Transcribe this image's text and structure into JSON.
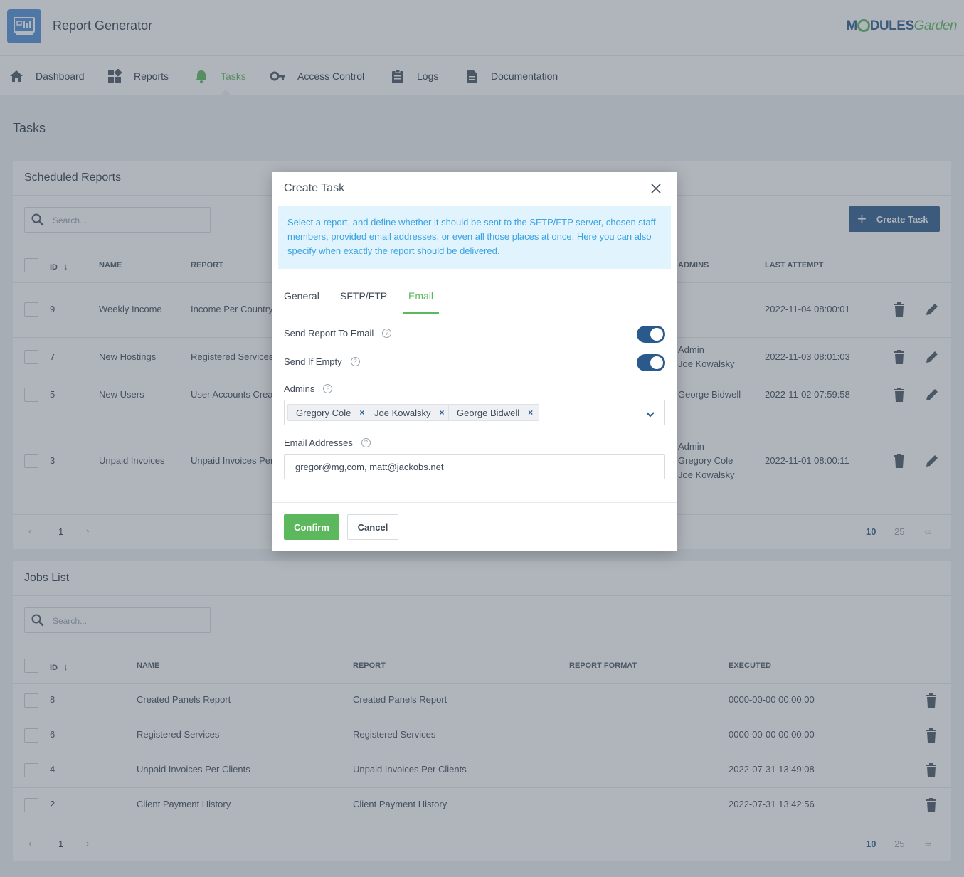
{
  "header": {
    "app_title": "Report Generator",
    "logo": {
      "modules": "M",
      "o": "",
      "dules": "DULES",
      "garden": "Garden"
    }
  },
  "nav": {
    "items": [
      {
        "label": "Dashboard",
        "icon": "home-icon"
      },
      {
        "label": "Reports",
        "icon": "dashboard-blocks-icon"
      },
      {
        "label": "Tasks",
        "icon": "bell-icon"
      },
      {
        "label": "Access Control",
        "icon": "key-icon"
      },
      {
        "label": "Logs",
        "icon": "clipboard-icon"
      },
      {
        "label": "Documentation",
        "icon": "document-icon"
      }
    ],
    "active": "Tasks"
  },
  "page_title": "Tasks",
  "scheduled": {
    "title": "Scheduled Reports",
    "search_placeholder": "Search...",
    "create_button": "Create Task",
    "columns": {
      "id": "ID",
      "name": "NAME",
      "report": "REPORT",
      "admins": "ADMINS",
      "last_attempt": "LAST ATTEMPT"
    },
    "rows": [
      {
        "id": "9",
        "name": "Weekly Income",
        "report": "Income Per Country",
        "admins": [],
        "last_attempt": "2022-11-04 08:00:01"
      },
      {
        "id": "7",
        "name": "New Hostings",
        "report": "Registered Services",
        "admins": [
          "Admin",
          "Joe Kowalsky"
        ],
        "last_attempt": "2022-11-03 08:01:03"
      },
      {
        "id": "5",
        "name": "New Users",
        "report": "User Accounts Crea",
        "admins": [
          "George Bidwell"
        ],
        "last_attempt": "2022-11-02 07:59:58"
      },
      {
        "id": "3",
        "name": "Unpaid Invoices",
        "report": "Unpaid Invoices Per",
        "admins": [
          "Admin",
          "Gregory Cole",
          "Joe Kowalsky"
        ],
        "last_attempt": "2022-11-01 08:00:11"
      }
    ],
    "pagination": {
      "current": "1",
      "sizes": [
        "10",
        "25",
        "∞"
      ],
      "active_size": "10"
    }
  },
  "jobs": {
    "title": "Jobs List",
    "search_placeholder": "Search...",
    "columns": {
      "id": "ID",
      "name": "NAME",
      "report": "REPORT",
      "format": "REPORT FORMAT",
      "executed": "EXECUTED"
    },
    "rows": [
      {
        "id": "8",
        "name": "Created Panels Report",
        "report": "Created Panels Report",
        "format": "",
        "executed": "0000-00-00 00:00:00"
      },
      {
        "id": "6",
        "name": "Registered Services",
        "report": "Registered Services",
        "format": "",
        "executed": "0000-00-00 00:00:00"
      },
      {
        "id": "4",
        "name": "Unpaid Invoices Per Clients",
        "report": "Unpaid Invoices Per Clients",
        "format": "",
        "executed": "2022-07-31 13:49:08"
      },
      {
        "id": "2",
        "name": "Client Payment History",
        "report": "Client Payment History",
        "format": "",
        "executed": "2022-07-31 13:42:56"
      }
    ],
    "pagination": {
      "current": "1",
      "sizes": [
        "10",
        "25",
        "∞"
      ],
      "active_size": "10"
    }
  },
  "modal": {
    "title": "Create Task",
    "info": "Select a report, and define whether it should be sent to the SFTP/FTP server, chosen staff members, provided email addresses, or even all those places at once. Here you can also specify when exactly the report should be delivered.",
    "tabs": [
      "General",
      "SFTP/FTP",
      "Email"
    ],
    "active_tab": "Email",
    "send_to_email_label": "Send Report To Email",
    "send_to_email": true,
    "send_if_empty_label": "Send If Empty",
    "send_if_empty": true,
    "admins_label": "Admins",
    "admins_selected": [
      "Gregory Cole",
      "Joe Kowalsky",
      "George Bidwell"
    ],
    "email_label": "Email Addresses",
    "email_value": "gregor@mg,com, matt@jackobs.net",
    "confirm": "Confirm",
    "cancel": "Cancel"
  },
  "colors": {
    "accent_green": "#5cb85c",
    "primary_blue": "#2a5a8c",
    "info_bg": "#e1f3fd",
    "info_text": "#3aa3e3"
  }
}
